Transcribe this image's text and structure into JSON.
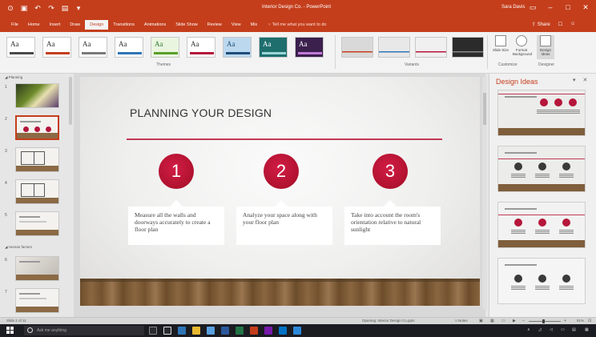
{
  "window": {
    "doc_title": "Interior Design Co. - PowerPoint",
    "user_name": "Sara Davis"
  },
  "ribbon_tabs": [
    "File",
    "Home",
    "Insert",
    "Draw",
    "Design",
    "Transitions",
    "Animations",
    "Slide Show",
    "Review",
    "View",
    "Mix"
  ],
  "active_tab": "Design",
  "tell_me": "Tell me what you want to do",
  "share_label": "Share",
  "ribbon": {
    "themes_label": "Themes",
    "variants_label": "Variants",
    "customize_label": "Customize",
    "designer_label": "Designer",
    "slide_size": "Slide Size",
    "format_background": "Format Background",
    "design_ideas_btn": "Design Ideas"
  },
  "theme_thumbs": [
    {
      "text": "Aa",
      "bg": "#ffffff",
      "fg": "#333333",
      "stripe": "#4a4a4a"
    },
    {
      "text": "Aa",
      "bg": "#ffffff",
      "fg": "#333333",
      "stripe": "#c43e1c"
    },
    {
      "text": "Aa",
      "bg": "#ffffff",
      "fg": "#333333",
      "stripe": "#7a7a7a"
    },
    {
      "text": "Aa",
      "bg": "#ffffff",
      "fg": "#333333",
      "stripe": "#2e75b6"
    },
    {
      "text": "Aa",
      "bg": "#eaf5e0",
      "fg": "#2e7d32",
      "stripe": "#5aa02c"
    },
    {
      "text": "Aa",
      "bg": "#ffffff",
      "fg": "#333333",
      "stripe": "#b5163a"
    },
    {
      "text": "Aa",
      "bg": "#bcd8ee",
      "fg": "#1f4e79",
      "stripe": "#1f4e79"
    },
    {
      "text": "Aa",
      "bg": "#1e6e6e",
      "fg": "#ffffff",
      "stripe": "#9ad6d6"
    },
    {
      "text": "Aa",
      "bg": "#3b1f4d",
      "fg": "#ffffff",
      "stripe": "#c07ad6"
    }
  ],
  "variant_thumbs": [
    {
      "bg": "#d9d9d9",
      "accent": "#c43e1c"
    },
    {
      "bg": "#e8e8e8",
      "accent": "#2e75b6"
    },
    {
      "bg": "#f0f0f0",
      "accent": "#b5163a"
    },
    {
      "bg": "#2b2b2b",
      "accent": "#888888"
    }
  ],
  "thumbnails": {
    "sections": [
      "Planning",
      "Human factors"
    ],
    "slides": [
      {
        "num": "1",
        "kind": "cover"
      },
      {
        "num": "2",
        "kind": "steps",
        "selected": true
      },
      {
        "num": "3",
        "kind": "plan"
      },
      {
        "num": "4",
        "kind": "plan"
      },
      {
        "num": "5",
        "kind": "text"
      },
      {
        "num": "6",
        "kind": "cover2"
      },
      {
        "num": "7",
        "kind": "text"
      }
    ]
  },
  "slide": {
    "title": "PLANNING YOUR DESIGN",
    "steps": [
      {
        "num": "1",
        "text": "Measure all the walls and doorways accurately to create a floor plan"
      },
      {
        "num": "2",
        "text": "Analyze your space along with your floor plan"
      },
      {
        "num": "3",
        "text": "Take into account the room's orientation relative to natural sunlight"
      }
    ],
    "accent_color": "#b5163a"
  },
  "design_pane": {
    "title": "Design Ideas",
    "ideas": [
      {
        "layout": "red-dots-right"
      },
      {
        "layout": "gray-dots"
      },
      {
        "layout": "red-dots-banded"
      },
      {
        "layout": "gray-dots-plain"
      }
    ]
  },
  "status": {
    "slide_count": "Slide 2 of 11",
    "doc_status": "Opening: Interior Design Co.pptx",
    "notes": "Notes",
    "zoom": "51%",
    "zoom_fraction": 0.45
  },
  "taskbar": {
    "search_placeholder": "Ask me anything"
  }
}
